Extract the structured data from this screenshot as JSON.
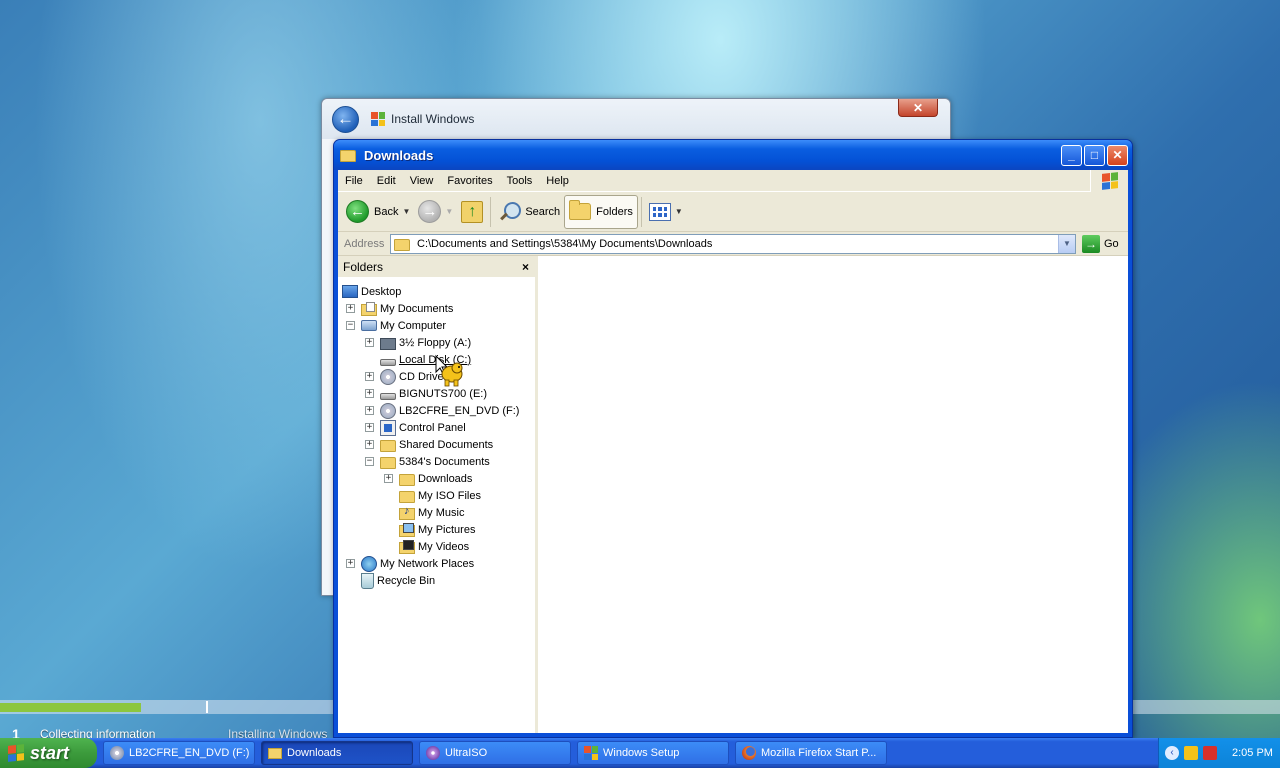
{
  "setup_window": {
    "title": "Install Windows",
    "close_label": "✕"
  },
  "setup_progress": {
    "steps": [
      "Collecting information",
      "Installing Windows"
    ],
    "step_number": "1",
    "progress_fraction": 0.11
  },
  "explorer": {
    "title": "Downloads",
    "menu": [
      "File",
      "Edit",
      "View",
      "Favorites",
      "Tools",
      "Help"
    ],
    "toolbar": {
      "back_label": "Back",
      "search_label": "Search",
      "folders_label": "Folders"
    },
    "address": {
      "label": "Address",
      "value": "C:\\Documents and Settings\\5384\\My Documents\\Downloads",
      "go_label": "Go"
    },
    "folders_pane": {
      "title": "Folders",
      "close_label": "×",
      "tree": [
        {
          "label": "Desktop",
          "icon": "desktop-icon",
          "level": 0,
          "expander": ""
        },
        {
          "label": "My Documents",
          "icon": "my-documents-icon",
          "level": 1,
          "expander": "+"
        },
        {
          "label": "My Computer",
          "icon": "my-computer-icon",
          "level": 1,
          "expander": "−"
        },
        {
          "label": "3½ Floppy (A:)",
          "icon": "floppy-icon",
          "level": 2,
          "expander": "+"
        },
        {
          "label": "Local Disk (C:)",
          "icon": "hard-disk-icon",
          "level": 2,
          "expander": ""
        },
        {
          "label": "CD Drive",
          "icon": "cd-drive-icon",
          "level": 2,
          "expander": "+"
        },
        {
          "label": "BIGNUTS700 (E:)",
          "icon": "drive-icon",
          "level": 2,
          "expander": "+"
        },
        {
          "label": "LB2CFRE_EN_DVD (F:)",
          "icon": "dvd-drive-icon",
          "level": 2,
          "expander": "+"
        },
        {
          "label": "Control Panel",
          "icon": "control-panel-icon",
          "level": 2,
          "expander": "+"
        },
        {
          "label": "Shared Documents",
          "icon": "folder-icon",
          "level": 2,
          "expander": "+"
        },
        {
          "label": "5384's Documents",
          "icon": "folder-icon",
          "level": 2,
          "expander": "−"
        },
        {
          "label": "Downloads",
          "icon": "folder-icon",
          "level": 3,
          "expander": "+"
        },
        {
          "label": "My ISO Files",
          "icon": "folder-icon",
          "level": 3,
          "expander": ""
        },
        {
          "label": "My Music",
          "icon": "music-folder-icon",
          "level": 3,
          "expander": ""
        },
        {
          "label": "My Pictures",
          "icon": "pictures-folder-icon",
          "level": 3,
          "expander": ""
        },
        {
          "label": "My Videos",
          "icon": "videos-folder-icon",
          "level": 3,
          "expander": ""
        },
        {
          "label": "My Network Places",
          "icon": "network-places-icon",
          "level": 1,
          "expander": "+"
        },
        {
          "label": "Recycle Bin",
          "icon": "recycle-bin-icon",
          "level": 1,
          "expander": ""
        }
      ]
    }
  },
  "taskbar": {
    "start_label": "start",
    "tasks": [
      {
        "label": "LB2CFRE_EN_DVD (F:)",
        "icon": "dvd-drive-icon",
        "active": false
      },
      {
        "label": "Downloads",
        "icon": "folder-icon",
        "active": true
      },
      {
        "label": "UltraISO",
        "icon": "ultraiso-icon",
        "active": false
      },
      {
        "label": "Windows Setup",
        "icon": "windows-setup-icon",
        "active": false
      },
      {
        "label": "Mozilla Firefox Start P...",
        "icon": "firefox-icon",
        "active": false
      }
    ],
    "clock": "2:05 PM"
  },
  "colors": {
    "xp_blue": "#0a4fd8",
    "start_green": "#3c9b3c",
    "progress_green": "#8cc63f"
  }
}
